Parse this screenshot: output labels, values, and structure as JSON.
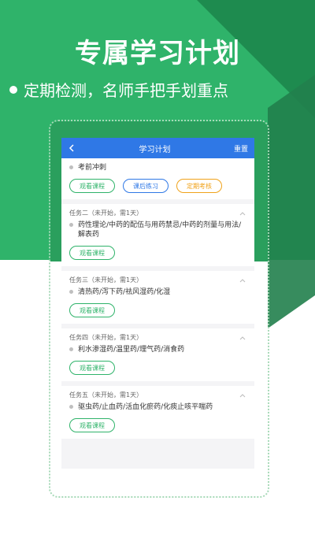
{
  "promo": {
    "headline": "专属学习计划",
    "subline": "定期检测，名师手把手划重点"
  },
  "app": {
    "title": "学习计划",
    "reset_label": "重置"
  },
  "top_section": {
    "item": "考前冲刺",
    "buttons": {
      "watch": "观看课程",
      "exercise": "课后练习",
      "exam": "定期考核"
    }
  },
  "tasks": [
    {
      "header": "任务二（未开始，需1天）",
      "item": "药性理论/中药的配伍与用药禁忌/中药的剂量与用法/解表药",
      "button": "观看课程"
    },
    {
      "header": "任务三（未开始，需1天）",
      "item": "清热药/泻下药/祛风湿药/化湿",
      "button": "观看课程"
    },
    {
      "header": "任务四（未开始，需1天）",
      "item": "利水渗湿药/温里药/理气药/消食药",
      "button": "观看课程"
    },
    {
      "header": "任务五（未开始，需1天）",
      "item": "驱虫药/止血药/活血化瘀药/化痰止咳平喘药",
      "button": "观看课程"
    }
  ],
  "colors": {
    "brand_green": "#2fb36a",
    "app_blue": "#2f78e6",
    "accent_orange": "#f0a21a"
  }
}
